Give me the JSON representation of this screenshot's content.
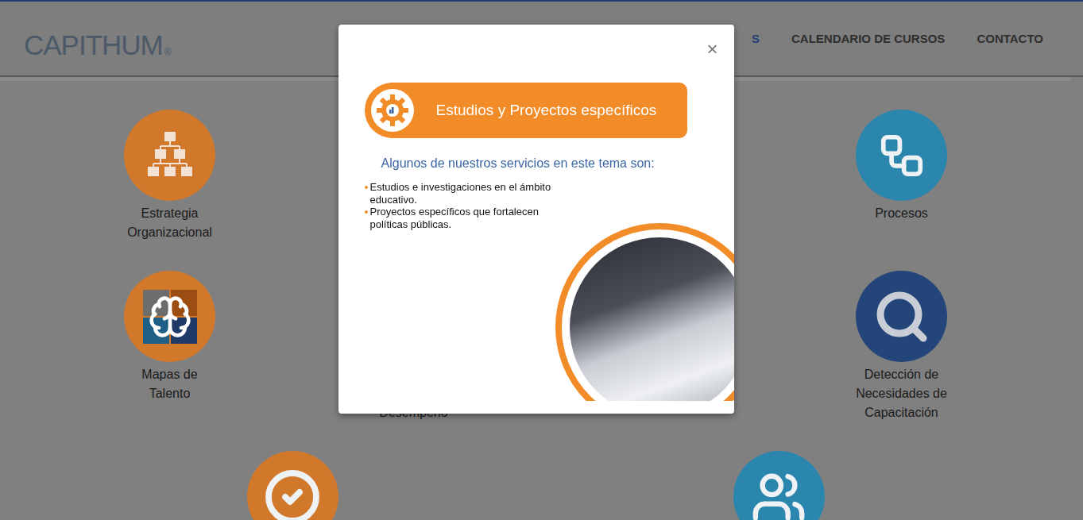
{
  "header": {
    "logo": {
      "text": "CAPITHUM",
      "mark": "®"
    },
    "nav": [
      {
        "label": "S",
        "selected": true
      },
      {
        "label": "CALENDARIO DE CURSOS",
        "selected": false
      },
      {
        "label": "CONTACTO",
        "selected": false
      }
    ]
  },
  "services": [
    {
      "items": [
        {
          "lines": [
            "Estrategia",
            "Organizacional"
          ],
          "icon": "org-chart",
          "color": "#d2782b",
          "covered": false
        },
        {
          "lines": [],
          "icon": "none",
          "color": "#d2782b",
          "covered": true
        },
        {
          "lines": [],
          "icon": "none",
          "color": "#2b86ad",
          "covered": true
        },
        {
          "lines": [
            "Procesos"
          ],
          "icon": "process",
          "color": "#2b86ad",
          "covered": false
        }
      ]
    },
    {
      "items": [
        {
          "lines": [
            "Mapas de",
            "Talento"
          ],
          "icon": "brain",
          "color": "#d2782b",
          "covered": false
        },
        {
          "lines": [
            "Desempeño"
          ],
          "icon": "none",
          "color": "#d2782b",
          "covered": true
        },
        {
          "lines": [],
          "icon": "none",
          "color": "#2b86ad",
          "covered": true
        },
        {
          "lines": [
            "Detección de",
            "Necesidades de",
            "Capacitación"
          ],
          "icon": "search",
          "color": "#23457a",
          "covered": false
        }
      ]
    },
    {
      "items": [
        {
          "lines": [],
          "icon": "check",
          "color": "#d2782b",
          "covered": false
        },
        {
          "lines": [],
          "icon": "team",
          "color": "#2b86ad",
          "covered": false
        }
      ]
    }
  ],
  "modal": {
    "close": "×",
    "title": "Estudios y Proyectos específicos",
    "subtitle": "Algunos de nuestros servicios en este tema son:",
    "bullets": [
      "Estudios e investigaciones en el ámbito educativo.",
      "Proyectos específicos que fortalecen políticas públicas."
    ]
  }
}
